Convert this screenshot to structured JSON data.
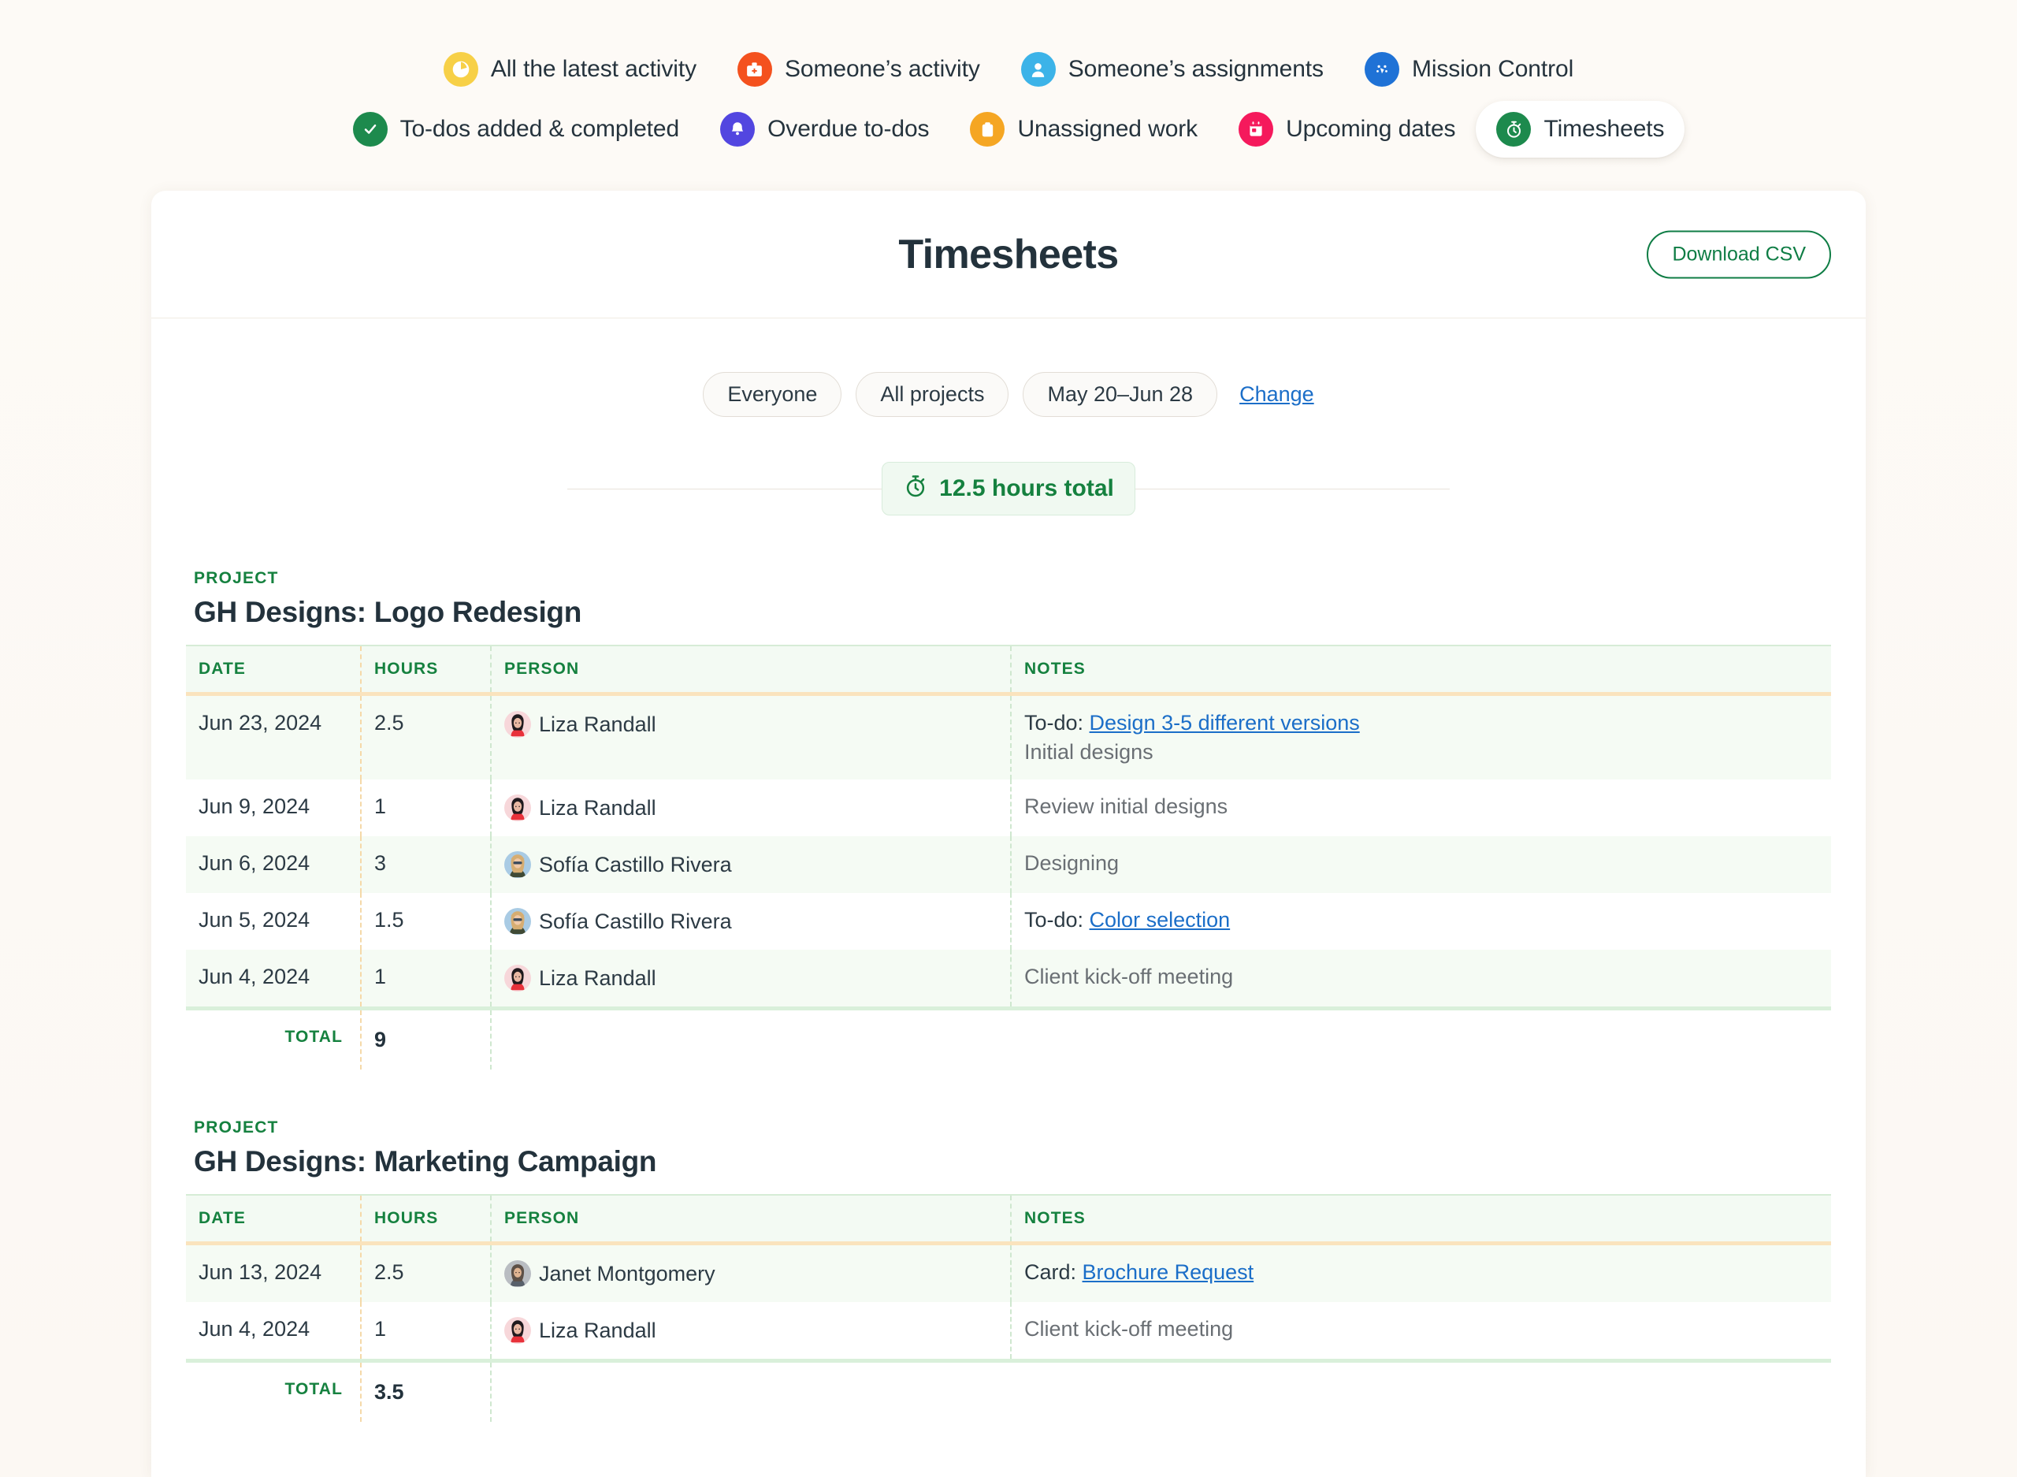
{
  "nav": {
    "rows": [
      [
        {
          "label": "All the latest activity",
          "icon": "clock-pie-icon",
          "color": "#f7d047",
          "active": false
        },
        {
          "label": "Someone’s activity",
          "icon": "briefcase-icon",
          "color": "#f4511e",
          "active": false
        },
        {
          "label": "Someone’s assignments",
          "icon": "person-icon",
          "color": "#3cb3e8",
          "active": false
        },
        {
          "label": "Mission Control",
          "icon": "gauge-icon",
          "color": "#1f72d6",
          "active": false
        }
      ],
      [
        {
          "label": "To-dos added & completed",
          "icon": "check-circle-icon",
          "color": "#1d8a4d",
          "active": false
        },
        {
          "label": "Overdue to-dos",
          "icon": "bell-icon",
          "color": "#5246e0",
          "active": false
        },
        {
          "label": "Unassigned work",
          "icon": "clipboard-icon",
          "color": "#f5a623",
          "active": false
        },
        {
          "label": "Upcoming dates",
          "icon": "calendar-icon",
          "color": "#f5195c",
          "active": false
        },
        {
          "label": "Timesheets",
          "icon": "stopwatch-icon",
          "color": "#1d8a4d",
          "active": true
        }
      ]
    ]
  },
  "header": {
    "title": "Timesheets",
    "download_label": "Download CSV"
  },
  "filters": {
    "people": "Everyone",
    "projects": "All projects",
    "date_range": "May 20–Jun 28",
    "change_label": "Change"
  },
  "total_badge": {
    "icon": "stopwatch-icon",
    "text": "12.5 hours total"
  },
  "columns": {
    "date": "DATE",
    "hours": "HOURS",
    "person": "PERSON",
    "notes": "NOTES"
  },
  "total_label": "TOTAL",
  "projects": [
    {
      "eyebrow": "PROJECT",
      "name": "GH Designs: Logo Redesign",
      "total": "9",
      "rows": [
        {
          "date": "Jun 23, 2024",
          "hours": "2.5",
          "person": "Liza Randall",
          "avatar": "liza",
          "note_prefix": "To-do: ",
          "note_link": "Design 3-5 different versions",
          "note_sub": "Initial designs",
          "note_plain": ""
        },
        {
          "date": "Jun 9, 2024",
          "hours": "1",
          "person": "Liza Randall",
          "avatar": "liza",
          "note_prefix": "",
          "note_link": "",
          "note_sub": "",
          "note_plain": "Review initial designs"
        },
        {
          "date": "Jun 6, 2024",
          "hours": "3",
          "person": "Sofía Castillo Rivera",
          "avatar": "sofia",
          "note_prefix": "",
          "note_link": "",
          "note_sub": "",
          "note_plain": "Designing"
        },
        {
          "date": "Jun 5, 2024",
          "hours": "1.5",
          "person": "Sofía Castillo Rivera",
          "avatar": "sofia",
          "note_prefix": "To-do: ",
          "note_link": "Color selection",
          "note_sub": "",
          "note_plain": ""
        },
        {
          "date": "Jun 4, 2024",
          "hours": "1",
          "person": "Liza Randall",
          "avatar": "liza",
          "note_prefix": "",
          "note_link": "",
          "note_sub": "",
          "note_plain": "Client kick-off meeting"
        }
      ]
    },
    {
      "eyebrow": "PROJECT",
      "name": "GH Designs: Marketing Campaign",
      "total": "3.5",
      "rows": [
        {
          "date": "Jun 13, 2024",
          "hours": "2.5",
          "person": "Janet Montgomery",
          "avatar": "janet",
          "note_prefix": "Card: ",
          "note_link": "Brochure Request",
          "note_sub": "",
          "note_plain": ""
        },
        {
          "date": "Jun 4, 2024",
          "hours": "1",
          "person": "Liza Randall",
          "avatar": "liza",
          "note_prefix": "",
          "note_link": "",
          "note_sub": "",
          "note_plain": "Client kick-off meeting"
        }
      ]
    }
  ]
}
